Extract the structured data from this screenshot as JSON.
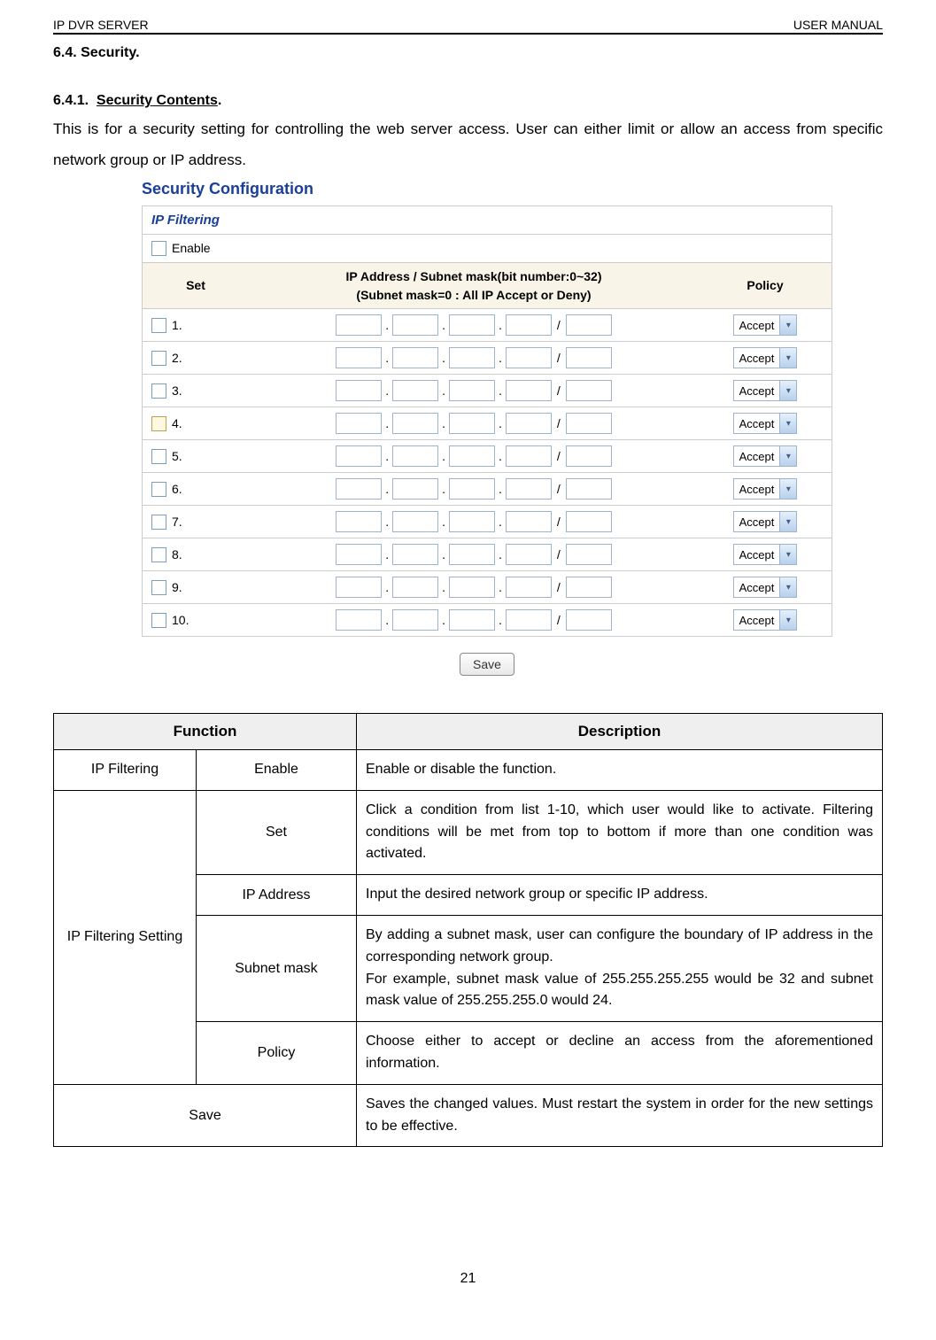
{
  "header": {
    "left": "IP DVR SERVER",
    "right": "USER MANUAL"
  },
  "sec_heading": "6.4. Security.",
  "sub_heading_prefix": "6.4.1.",
  "sub_heading_title": "Security Contents",
  "sub_heading_suffix": ".",
  "body_text": "This is for a security setting for controlling the web server access. User can either limit or allow an access from specific network group or IP address.",
  "config": {
    "title": "Security Configuration",
    "panel_title": "IP Filtering",
    "enable_label": "Enable",
    "head_set": "Set",
    "head_ip_line1": "IP Address / Subnet mask(bit number:0~32)",
    "head_ip_line2": "(Subnet mask=0  : All IP Accept or Deny)",
    "head_policy": "Policy",
    "rows": [
      {
        "n": "1.",
        "policy": "Accept",
        "amber": false
      },
      {
        "n": "2.",
        "policy": "Accept",
        "amber": false
      },
      {
        "n": "3.",
        "policy": "Accept",
        "amber": false
      },
      {
        "n": "4.",
        "policy": "Accept",
        "amber": true
      },
      {
        "n": "5.",
        "policy": "Accept",
        "amber": false
      },
      {
        "n": "6.",
        "policy": "Accept",
        "amber": false
      },
      {
        "n": "7.",
        "policy": "Accept",
        "amber": false
      },
      {
        "n": "8.",
        "policy": "Accept",
        "amber": false
      },
      {
        "n": "9.",
        "policy": "Accept",
        "amber": false
      },
      {
        "n": "10.",
        "policy": "Accept",
        "amber": false
      }
    ],
    "save": "Save"
  },
  "desc": {
    "h_function": "Function",
    "h_description": "Description",
    "rows": [
      {
        "c1": "IP Filtering",
        "c2": "Enable",
        "c3": "Enable or disable the function."
      },
      {
        "c1": "IP Filtering Setting",
        "c2": "Set",
        "c3": "Click a condition from list 1-10, which user would like to activate. Filtering conditions will be met from top to bottom if more than one condition was activated."
      },
      {
        "c2": "IP Address",
        "c3": "Input the desired network group or specific IP address."
      },
      {
        "c2": "Subnet mask",
        "c3": "By adding a subnet mask, user can configure the boundary of IP address in the corresponding network group.\nFor example, subnet mask value of 255.255.255.255 would be 32 and subnet mask value of 255.255.255.0 would 24."
      },
      {
        "c2": "Policy",
        "c3": "Choose either to accept or decline an access from the aforementioned information."
      },
      {
        "c1": "Save",
        "c3": "Saves the changed values. Must restart the system in order for the new settings to be effective."
      }
    ]
  },
  "pagenum": "21"
}
